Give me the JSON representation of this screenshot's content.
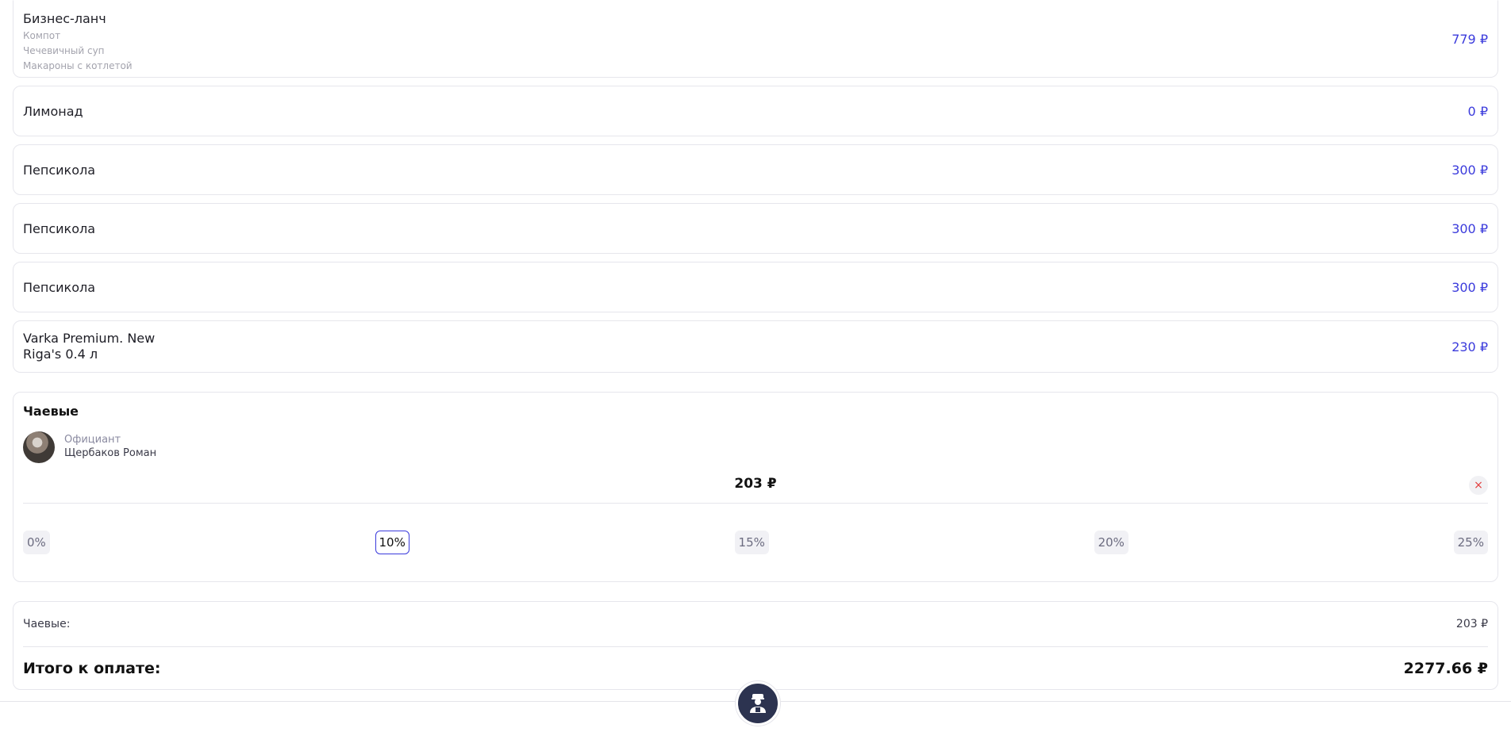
{
  "order": {
    "items": [
      {
        "name": "Бизнес-ланч",
        "modifiers": [
          "Компот",
          "Чечевичный суп",
          "Макароны с котлетой"
        ],
        "price": "779 ₽"
      },
      {
        "name": "Лимонад",
        "price": "0 ₽"
      },
      {
        "name": "Пепсикола",
        "price": "300 ₽"
      },
      {
        "name": "Пепсикола",
        "price": "300 ₽"
      },
      {
        "name": "Пепсикола",
        "price": "300 ₽"
      },
      {
        "name_line1": "Varka Premium. New",
        "name_line2": "Riga's 0.4 л",
        "price": "230 ₽"
      }
    ]
  },
  "tips": {
    "title": "Чаевые",
    "waiter_role": "Официант",
    "waiter_name": "Щербаков Роман",
    "amount": "203 ₽",
    "clear_icon": "×",
    "percent_options": [
      "0%",
      "10%",
      "15%",
      "20%",
      "25%"
    ],
    "selected_percent": "10%"
  },
  "summary": {
    "tips_label": "Чаевые:",
    "tips_value": "203 ₽",
    "total_label": "Итого к оплате:",
    "total_value": "2277.66 ₽"
  },
  "colors": {
    "accent": "#3b3bdc",
    "fab": "#2c3350",
    "danger": "#e23b3b"
  },
  "icons": {
    "fab": "waiter-icon"
  }
}
